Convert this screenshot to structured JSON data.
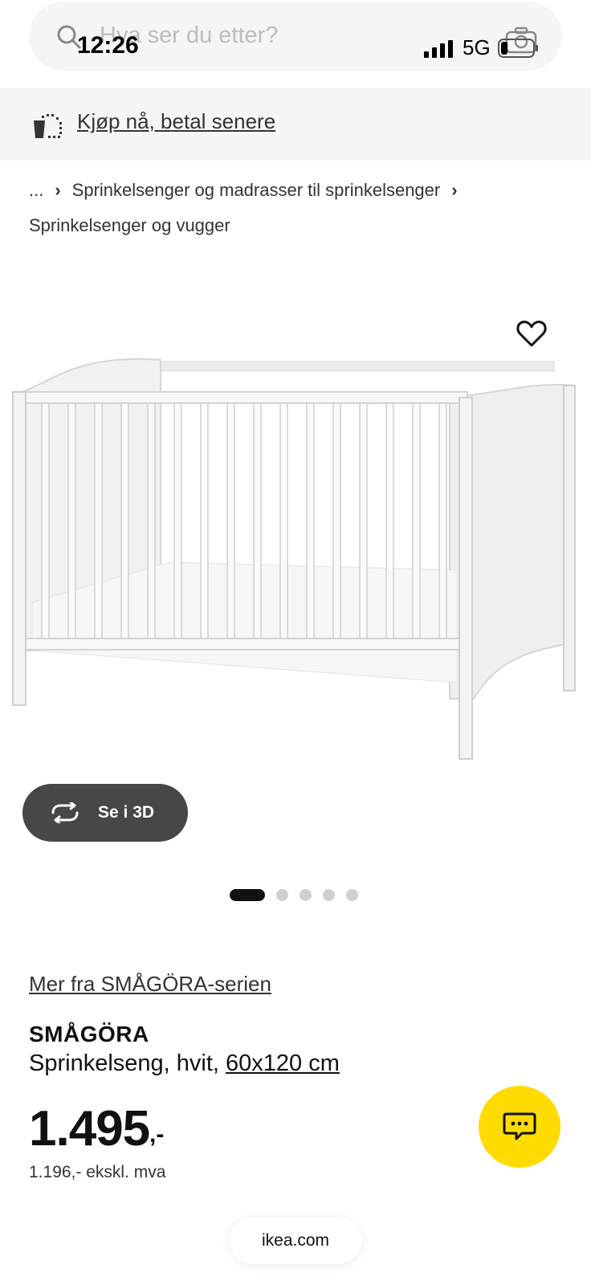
{
  "status_bar": {
    "time": "12:26",
    "network": "5G"
  },
  "search": {
    "placeholder": "Hva ser du etter?"
  },
  "promo": {
    "text": "Kjøp nå, betal senere"
  },
  "breadcrumb": {
    "ellipsis": "...",
    "category": "Sprinkelsenger og madrasser til sprinkelsenger",
    "current": "Sprinkelsenger og vugger"
  },
  "gallery": {
    "view_3d_label": "Se i 3D",
    "image_count": 5,
    "active_index": 0
  },
  "product": {
    "series_link": "Mer fra SMÅGÖRA-serien",
    "name": "SMÅGÖRA",
    "description": "Sprinkelseng, hvit,",
    "size": "60x120 cm",
    "price": "1.495",
    "price_suffix": ",-",
    "price_ex_vat": "1.196,- ekskl. mva"
  },
  "browser": {
    "url": "ikea.com"
  },
  "colors": {
    "accent": "#ffdb00",
    "dark_button": "#474747",
    "banner_bg": "#f5f5f5"
  }
}
